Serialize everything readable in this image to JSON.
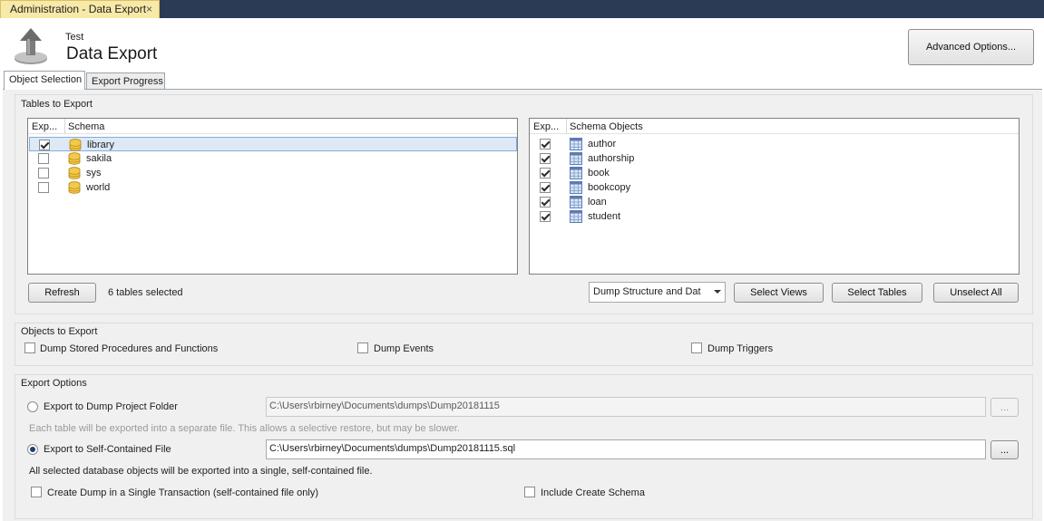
{
  "window": {
    "doc_tab": "Administration - Data Export",
    "close_glyph": "×"
  },
  "header": {
    "connection": "Test",
    "title": "Data Export",
    "advanced_button": "Advanced Options..."
  },
  "tabs": [
    {
      "label": "Object Selection",
      "active": true
    },
    {
      "label": "Export Progress",
      "active": false
    }
  ],
  "tables_to_export": {
    "title": "Tables to Export",
    "schema_list": {
      "columns": [
        "Exp...",
        "Schema"
      ],
      "rows": [
        {
          "name": "library",
          "checked": true,
          "selected": true
        },
        {
          "name": "sakila",
          "checked": false,
          "selected": false
        },
        {
          "name": "sys",
          "checked": false,
          "selected": false
        },
        {
          "name": "world",
          "checked": false,
          "selected": false
        }
      ]
    },
    "objects_list": {
      "columns": [
        "Exp...",
        "Schema Objects"
      ],
      "rows": [
        {
          "name": "author",
          "checked": true
        },
        {
          "name": "authorship",
          "checked": true
        },
        {
          "name": "book",
          "checked": true
        },
        {
          "name": "bookcopy",
          "checked": true
        },
        {
          "name": "loan",
          "checked": true
        },
        {
          "name": "student",
          "checked": true
        }
      ]
    },
    "refresh_button": "Refresh",
    "selection_status": "6 tables selected",
    "dump_mode": "Dump Structure and Dat",
    "select_views_button": "Select Views",
    "select_tables_button": "Select Tables",
    "unselect_all_button": "Unselect All"
  },
  "objects_to_export": {
    "title": "Objects to Export",
    "options": [
      {
        "label": "Dump Stored Procedures and Functions",
        "checked": false
      },
      {
        "label": "Dump Events",
        "checked": false
      },
      {
        "label": "Dump Triggers",
        "checked": false
      }
    ]
  },
  "export_options": {
    "title": "Export Options",
    "project_folder": {
      "label": "Export to Dump Project Folder",
      "selected": false,
      "path": "C:\\Users\\rbirney\\Documents\\dumps\\Dump20181115",
      "hint": "Each table will be exported into a separate file. This allows a selective restore, but may be slower.",
      "browse": "..."
    },
    "self_contained": {
      "label": "Export to Self-Contained File",
      "selected": true,
      "path": "C:\\Users\\rbirney\\Documents\\dumps\\Dump20181115.sql",
      "hint": "All selected database objects will be exported into a single, self-contained file.",
      "browse": "..."
    },
    "single_transaction": {
      "label": "Create Dump in a Single Transaction (self-contained file only)",
      "checked": false
    },
    "include_create_schema": {
      "label": "Include Create Schema",
      "checked": false
    }
  },
  "colors": {
    "topbar": "#2b3a55",
    "active_doc_tab": "#f7e9a8",
    "pane_background": "#f0f0f0",
    "selection": "#dde9f7"
  }
}
